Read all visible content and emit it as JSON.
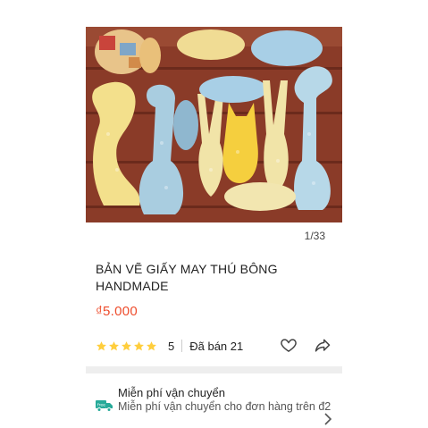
{
  "gallery": {
    "counter": "1/33"
  },
  "product": {
    "title_line1": "BẢN VẼ GIẤY MAY THÚ BÔNG",
    "title_line2": "HANDMADE",
    "price": "₫5.000",
    "rating": "5",
    "sold": "Đã bán 21"
  },
  "shipping": {
    "title": "Miễn phí vận chuyển",
    "description": "Miễn phí vận chuyển cho đơn hàng trên đ2"
  },
  "icons": {
    "star": "star-icon",
    "heart": "heart-icon",
    "share": "share-icon",
    "truck": "free-shipping-truck-icon",
    "chevron": "chevron-right-icon"
  },
  "colors": {
    "price": "#ee4d2d",
    "star": "#ffce3d",
    "truck": "#26aa99"
  }
}
